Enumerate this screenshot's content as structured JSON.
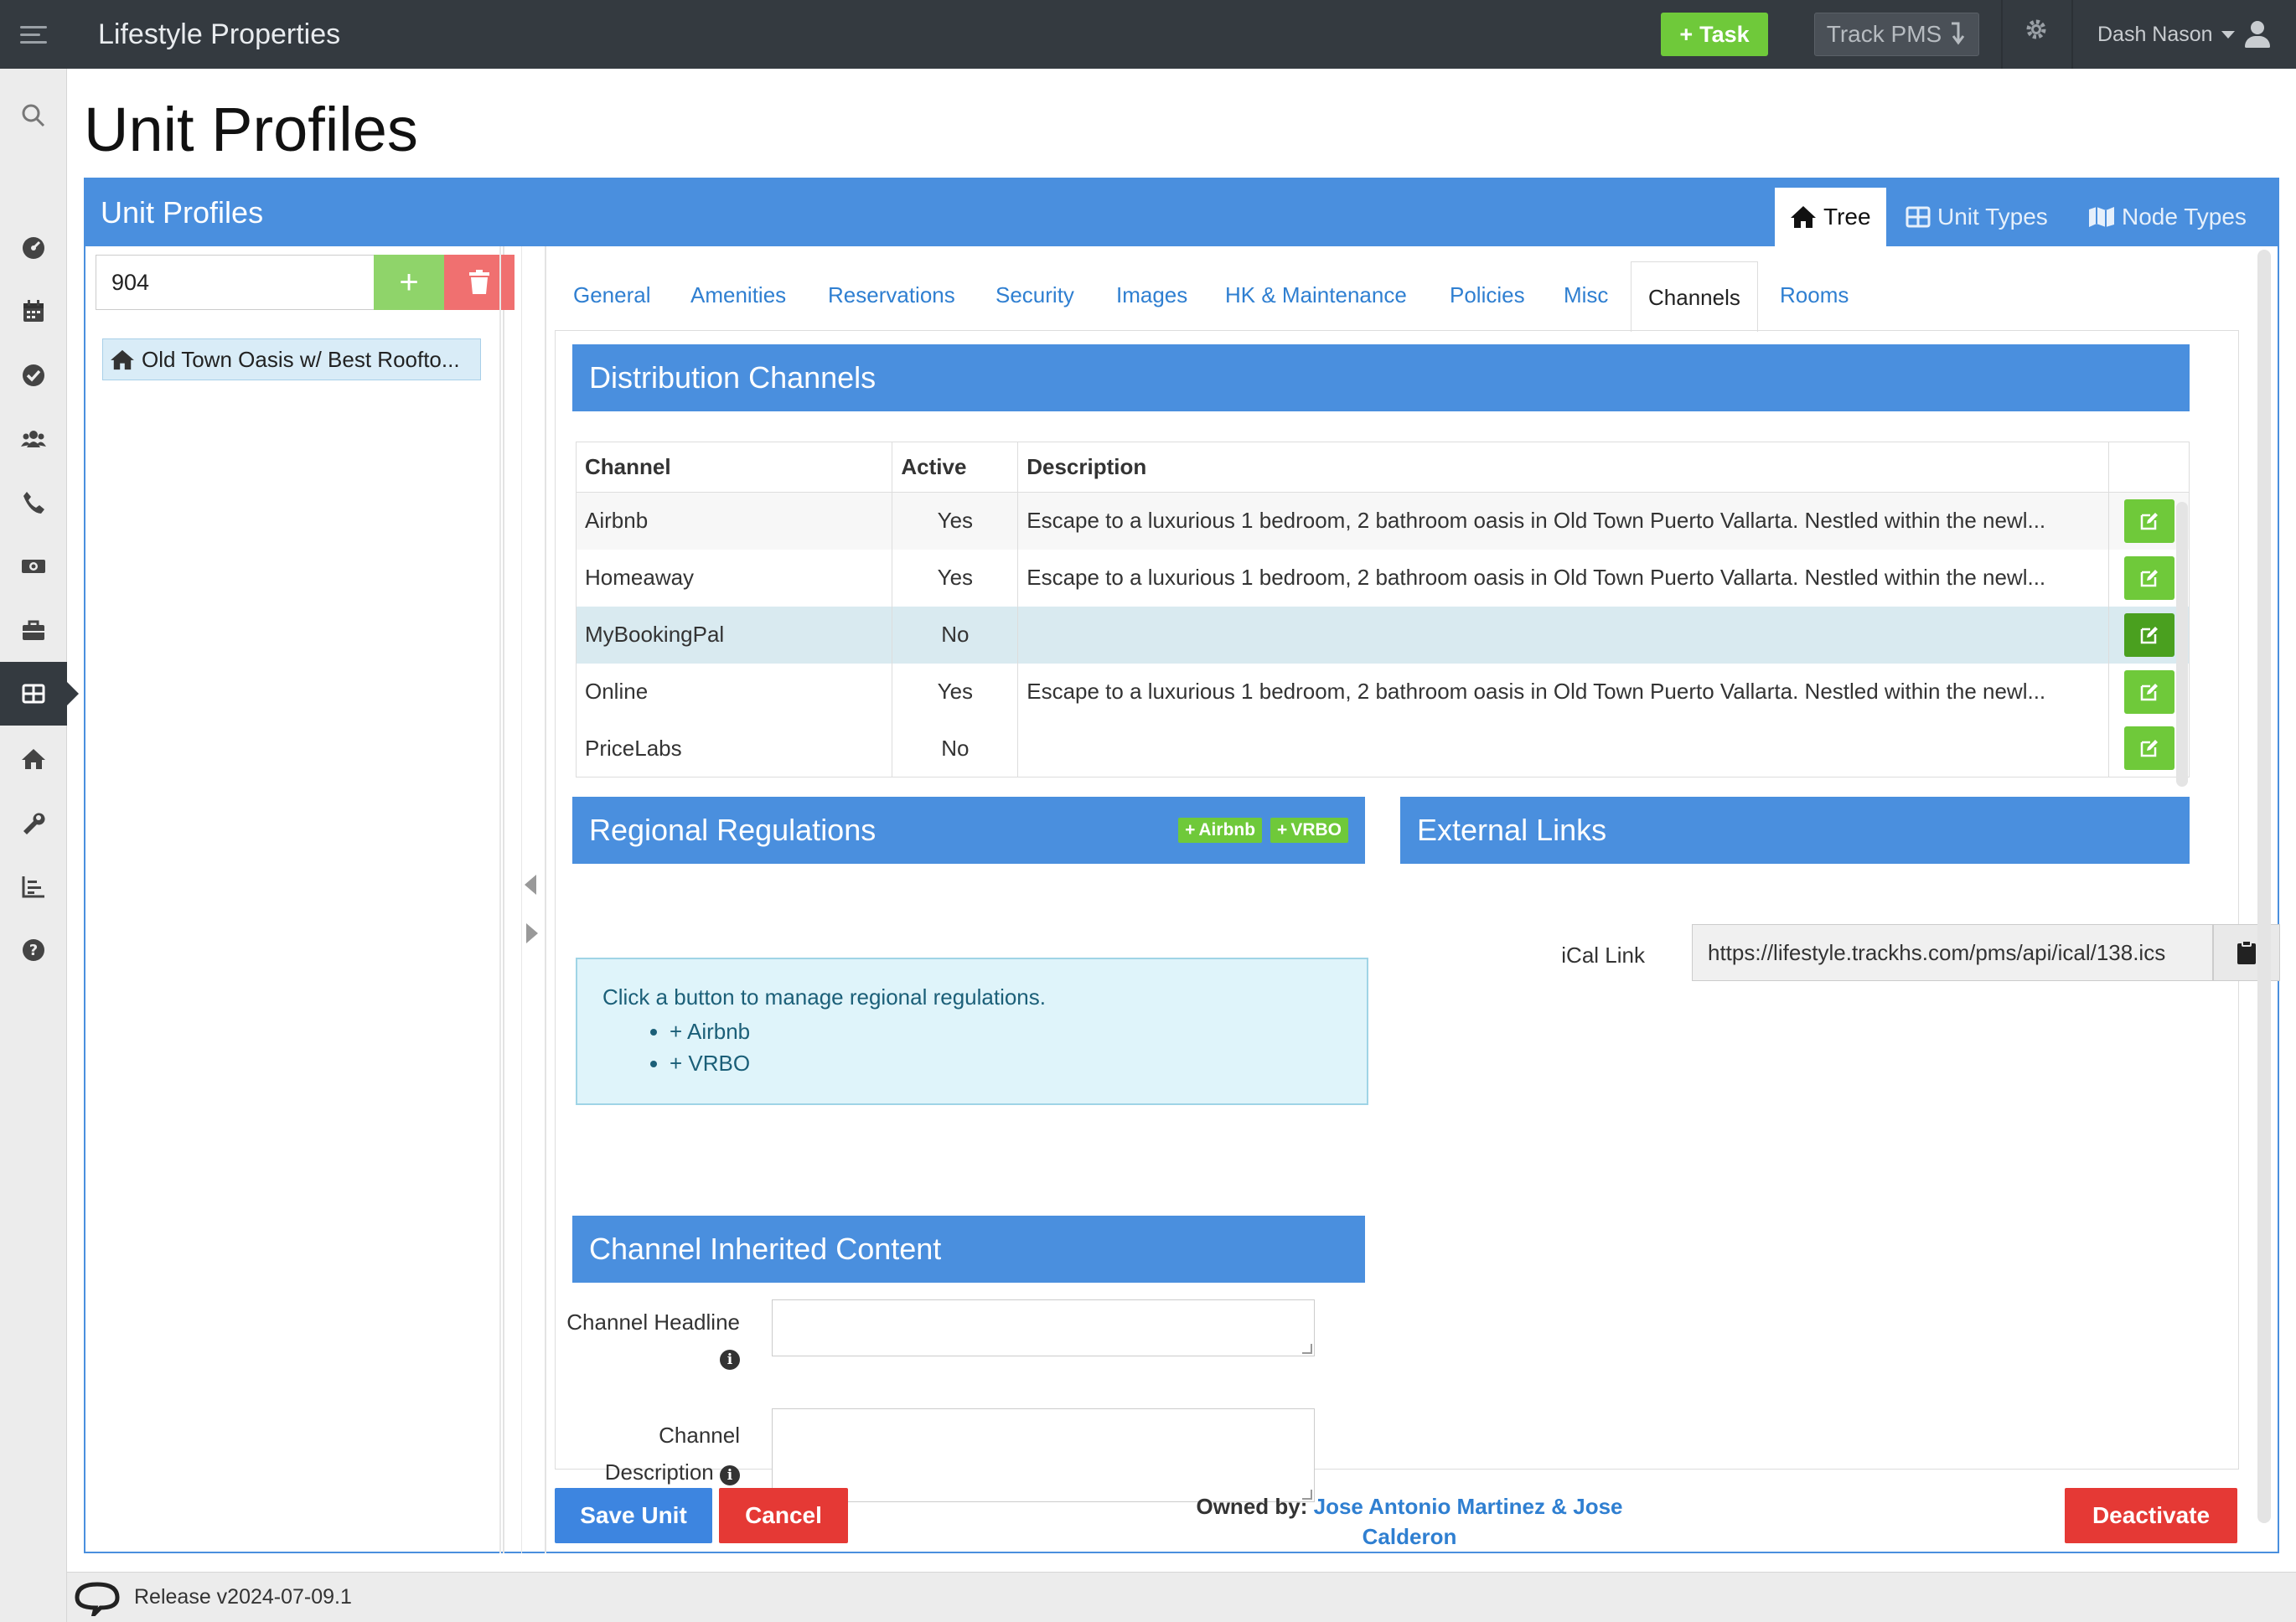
{
  "app": {
    "brand": "Lifestyle Properties"
  },
  "topbar": {
    "task_label": "Task",
    "track_label": "Track PMS",
    "user_name": "Dash Nason"
  },
  "sidebar": {
    "items": [
      {
        "icon": "search-icon"
      },
      {
        "icon": "dashboard-icon"
      },
      {
        "icon": "calendar-icon"
      },
      {
        "icon": "check-circle-icon"
      },
      {
        "icon": "users-icon"
      },
      {
        "icon": "phone-icon"
      },
      {
        "icon": "money-icon"
      },
      {
        "icon": "briefcase-icon"
      },
      {
        "icon": "grid-icon",
        "active": true
      },
      {
        "icon": "home-icon"
      },
      {
        "icon": "wrench-icon"
      },
      {
        "icon": "chart-icon"
      },
      {
        "icon": "help-icon"
      }
    ]
  },
  "page": {
    "title": "Unit Profiles"
  },
  "panel": {
    "title": "Unit Profiles",
    "header_tabs": [
      {
        "label": "Tree",
        "active": true
      },
      {
        "label": "Unit Types"
      },
      {
        "label": "Node Types"
      }
    ]
  },
  "tree": {
    "search_value": "904",
    "node_label": "Old Town Oasis w/ Best Roofto..."
  },
  "tabs": [
    {
      "label": "General"
    },
    {
      "label": "Amenities"
    },
    {
      "label": "Reservations"
    },
    {
      "label": "Security"
    },
    {
      "label": "Images"
    },
    {
      "label": "HK & Maintenance"
    },
    {
      "label": "Policies"
    },
    {
      "label": "Misc"
    },
    {
      "label": "Channels",
      "active": true
    },
    {
      "label": "Rooms"
    }
  ],
  "distribution": {
    "title": "Distribution Channels",
    "columns": [
      "Channel",
      "Active",
      "Description"
    ],
    "rows": [
      {
        "channel": "Airbnb",
        "active": "Yes",
        "description": "Escape to a luxurious 1 bedroom, 2 bathroom oasis in Old Town Puerto Vallarta. Nestled within the newl..."
      },
      {
        "channel": "Homeaway",
        "active": "Yes",
        "description": "Escape to a luxurious 1 bedroom, 2 bathroom oasis in Old Town Puerto Vallarta. Nestled within the newl..."
      },
      {
        "channel": "MyBookingPal",
        "active": "No",
        "description": ""
      },
      {
        "channel": "Online",
        "active": "Yes",
        "description": "Escape to a luxurious 1 bedroom, 2 bathroom oasis in Old Town Puerto Vallarta. Nestled within the newl..."
      },
      {
        "channel": "PriceLabs",
        "active": "No",
        "description": ""
      }
    ]
  },
  "regional": {
    "title": "Regional Regulations",
    "btn_airbnb": "Airbnb",
    "btn_vrbo": "VRBO",
    "info_text": "Click a button to manage regional regulations.",
    "links": [
      "Airbnb",
      "VRBO"
    ]
  },
  "external": {
    "title": "External Links",
    "ical_label": "iCal Link",
    "ical_value": "https://lifestyle.trackhs.com/pms/api/ical/138.ics"
  },
  "inherited": {
    "title": "Channel Inherited Content",
    "headline_label": "Channel Headline",
    "description_label_1": "Channel",
    "description_label_2": "Description"
  },
  "actions": {
    "save": "Save Unit",
    "cancel": "Cancel",
    "deactivate": "Deactivate",
    "owned_label": "Owned by:",
    "owned_line1": "Jose Antonio Martinez & Jose",
    "owned_line2": "Calderon"
  },
  "footer": {
    "release": "Release v2024-07-09.1"
  },
  "colors": {
    "primary": "#4a8fde",
    "success": "#6fc93a",
    "danger": "#e53935",
    "topbar": "#343a40"
  }
}
